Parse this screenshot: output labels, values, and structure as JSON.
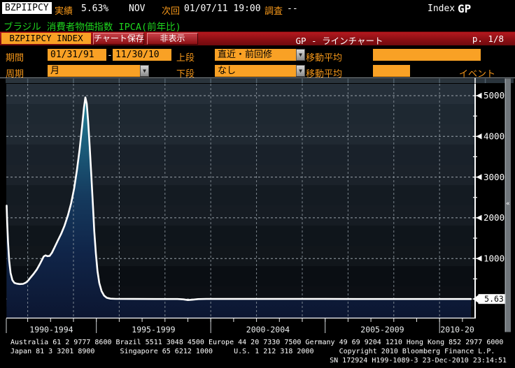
{
  "header": {
    "ticker": "BZPIIPCY",
    "actual_label": "実績",
    "actual_value": "5.63%",
    "period": "NOV",
    "next_label": "次回",
    "next_value": "01/07/11 19:00",
    "survey_label": "調査",
    "survey_value": "--",
    "index_label": "Index",
    "function_code": "GP"
  },
  "title": "ブラジル 消費者物価指数 IPCA(前年比)",
  "command_bar": {
    "security": "BZPIIPCY INDEX",
    "save_button": "チャート保存",
    "hide_button": "非表示",
    "chart_type": "GP - ラインチャート",
    "page": "p. 1/8"
  },
  "toolbar": {
    "period_label": "期間",
    "date_from": "01/31/91",
    "date_sep": "-",
    "date_to": "11/30/10",
    "upper_label": "上段",
    "upper_value": "直近・前回修",
    "ma_label": "移動平均",
    "freq_label": "周期",
    "freq_value": "月",
    "lower_label": "下段",
    "lower_value": "なし",
    "ma2_label": "移動平均",
    "event_label": "イベント"
  },
  "icons": {
    "dropdown_arrow": "▼",
    "scrollbar_collapse": "«"
  },
  "colors": {
    "accent_orange": "#f9a125",
    "title_green": "#1ed41e",
    "bar_red": "#9c1418",
    "line_white": "#ffffff",
    "fill_teal_top": "#26869a",
    "fill_navy_bottom": "#0c1631"
  },
  "chart_data": {
    "type": "area",
    "title": "ブラジル 消費者物価指数 IPCA(前年比)",
    "ylabel": "",
    "xlabel": "",
    "yticks": [
      1000,
      2000,
      3000,
      4000,
      5000
    ],
    "ylim": [
      -460,
      5330
    ],
    "xlim": [
      1991.07,
      2011.6
    ],
    "grid": {
      "on": true,
      "v_years": [
        1992,
        1994,
        1996,
        1998,
        2000,
        2002,
        2004,
        2006,
        2008,
        2010
      ]
    },
    "x_group_boundaries": [
      1991.07,
      1995,
      2000,
      2005,
      2010,
      2011.6
    ],
    "x_group_labels": [
      "1990-1994",
      "1995-1999",
      "2000-2004",
      "2005-2009",
      "2010-20"
    ],
    "last_value": "5.63",
    "last_value_num": 5.63,
    "series": [
      {
        "name": "BZPIIPCY Index",
        "points": [
          [
            1991.08,
            2300
          ],
          [
            1991.1,
            1900
          ],
          [
            1991.14,
            1400
          ],
          [
            1991.19,
            950
          ],
          [
            1991.25,
            645
          ],
          [
            1991.33,
            470
          ],
          [
            1991.42,
            402
          ],
          [
            1991.52,
            383
          ],
          [
            1991.65,
            372
          ],
          [
            1991.8,
            378
          ],
          [
            1991.92,
            408
          ],
          [
            1992.02,
            458
          ],
          [
            1992.12,
            530
          ],
          [
            1992.25,
            618
          ],
          [
            1992.4,
            732
          ],
          [
            1992.52,
            852
          ],
          [
            1992.62,
            962
          ],
          [
            1992.7,
            1052
          ],
          [
            1992.78,
            1078
          ],
          [
            1992.86,
            1058
          ],
          [
            1992.96,
            1066
          ],
          [
            1993.06,
            1140
          ],
          [
            1993.18,
            1282
          ],
          [
            1993.31,
            1432
          ],
          [
            1993.46,
            1602
          ],
          [
            1993.61,
            1806
          ],
          [
            1993.76,
            2062
          ],
          [
            1993.9,
            2360
          ],
          [
            1994.03,
            2725
          ],
          [
            1994.15,
            3165
          ],
          [
            1994.27,
            3685
          ],
          [
            1994.38,
            4255
          ],
          [
            1994.46,
            4705
          ],
          [
            1994.52,
            4955
          ],
          [
            1994.58,
            4800
          ],
          [
            1994.64,
            4380
          ],
          [
            1994.71,
            3750
          ],
          [
            1994.78,
            3040
          ],
          [
            1994.85,
            2310
          ],
          [
            1994.91,
            1675
          ],
          [
            1994.98,
            1125
          ],
          [
            1995.05,
            695
          ],
          [
            1995.13,
            398
          ],
          [
            1995.23,
            198
          ],
          [
            1995.34,
            88
          ],
          [
            1995.46,
            34
          ],
          [
            1995.62,
            14
          ],
          [
            1995.85,
            8
          ],
          [
            1996.6,
            7
          ],
          [
            1997.6,
            6
          ],
          [
            1998.55,
            6
          ],
          [
            1998.8,
            -4
          ],
          [
            1999.0,
            -20
          ],
          [
            1999.2,
            -12
          ],
          [
            1999.45,
            3
          ],
          [
            1999.8,
            7
          ],
          [
            2001.0,
            7
          ],
          [
            2003.0,
            7
          ],
          [
            2005.0,
            7
          ],
          [
            2007.0,
            6
          ],
          [
            2009.0,
            6
          ],
          [
            2010.4,
            6
          ],
          [
            2010.92,
            5.63
          ]
        ]
      }
    ]
  },
  "footer": {
    "line1": "Australia 61 2 9777 8600 Brazil 5511 3048 4500 Europe 44 20 7330 7500 Germany 49 69 9204 1210 Hong Kong 852 2977 6000",
    "line2": "Japan 81 3 3201 8900      Singapore 65 6212 1000     U.S. 1 212 318 2000      Copyright 2010 Bloomberg Finance L.P.",
    "line3": "SN 172924 H199-1089-3 23-Dec-2010 23:14:51"
  }
}
